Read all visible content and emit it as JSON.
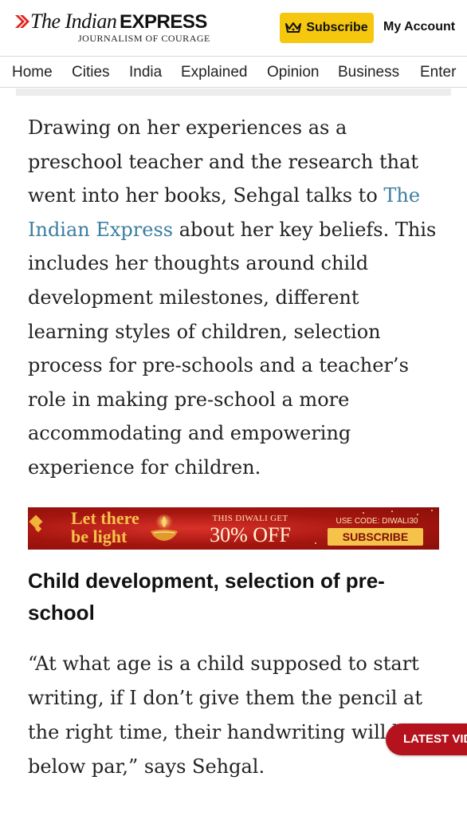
{
  "header": {
    "logo_the": "The Indian",
    "logo_express": "EXPRESS",
    "logo_tagline": "JOURNALISM OF COURAGE",
    "subscribe_label": "Subscribe",
    "account_label": "My Account",
    "brand_color": "#e1261c",
    "subscribe_color": "#f5c70f"
  },
  "nav": {
    "items": [
      "Home",
      "Cities",
      "India",
      "Explained",
      "Opinion",
      "Business",
      "Enter"
    ]
  },
  "article": {
    "para1_before_link": "Drawing on her experiences as a preschool teacher and the research that went into her books, Sehgal talks to ",
    "para1_link": "The Indian Express",
    "para1_after_link": " about her key beliefs. This includes her thoughts around child development milestones, different learning styles of children, selection process for pre-schools and a teacher’s role in making pre-school a more accommodating and empowering experience for children.",
    "heading": "Child development, selection of pre-school",
    "para2": "“At what age is a child supposed to start writing, if I don’t give them the pencil at the right time, their handwriting will be below par,” says Sehgal.",
    "link_color": "#3c7ea0"
  },
  "banner": {
    "line1": "Let there",
    "line2": "be light",
    "offer_top": "THIS DIWALI GET",
    "offer_main": "30% OFF",
    "code": "USE CODE: DIWALI30",
    "cta": "SUBSCRIBE NOW",
    "bg_color": "#b1170f",
    "accent_color": "#f5c24a"
  },
  "floating": {
    "latest_label": "LATEST VIDEOS",
    "color": "#b4121d"
  }
}
